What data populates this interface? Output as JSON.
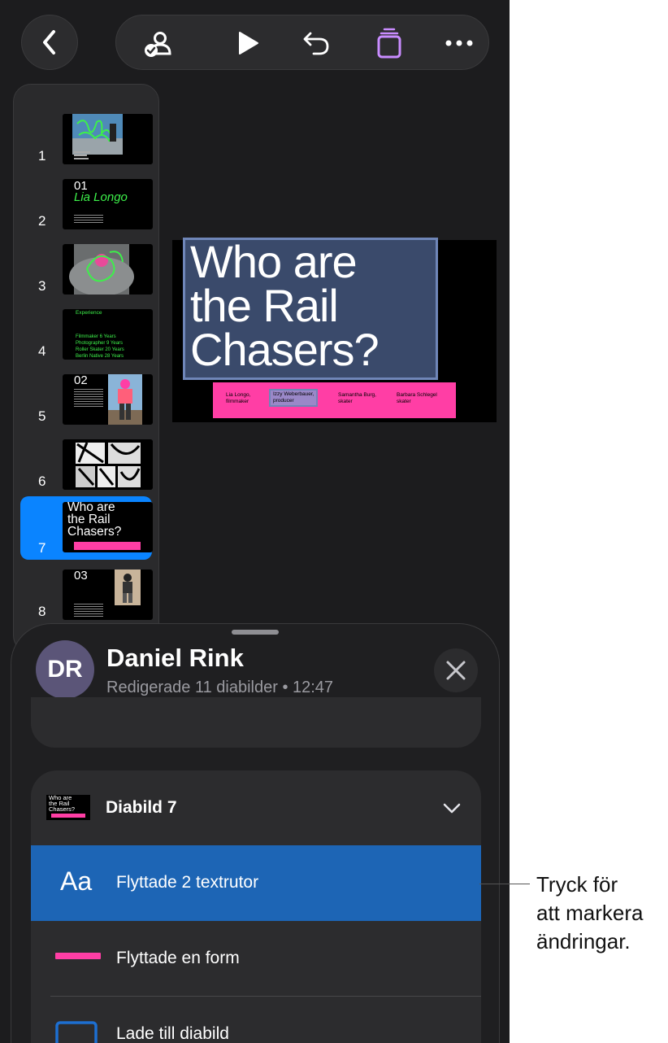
{
  "toolbar": {
    "back": "back",
    "icons": [
      "collaborate-icon",
      "play-icon",
      "undo-icon",
      "slides-stack-icon",
      "more-icon"
    ]
  },
  "navigator": {
    "slides": [
      {
        "number": "1",
        "text": "",
        "selected": false
      },
      {
        "number": "2",
        "heading": "01",
        "text": "Lia Longo",
        "selected": false
      },
      {
        "number": "3",
        "text": "",
        "selected": false
      },
      {
        "number": "4",
        "heading": "Experience",
        "rows": [
          "Filmmaker 6 Years",
          "Photographer 9 Years",
          "Roller Skater 20 Years",
          "Berlin Native 28 Years"
        ],
        "selected": false
      },
      {
        "number": "5",
        "heading": "02",
        "text": "",
        "selected": false
      },
      {
        "number": "6",
        "text": "",
        "selected": false
      },
      {
        "number": "7",
        "text": "Who are\nthe Rail\nChasers?",
        "selected": true
      },
      {
        "number": "8",
        "heading": "03",
        "text": "",
        "selected": false
      }
    ]
  },
  "slide": {
    "title": "Who are\nthe Rail\nChasers?",
    "credits": [
      {
        "name": "Lia Longo,",
        "role": "filmmaker"
      },
      {
        "name": "Izzy Weberbauer,",
        "role": "producer"
      },
      {
        "name": "Samantha Burg,",
        "role": "skater"
      },
      {
        "name": "Barbara Schlegel",
        "role": "skater"
      }
    ],
    "accent_color": "#ff3ea5"
  },
  "sheet": {
    "avatar_initials": "DR",
    "user_name": "Daniel Rink",
    "subtitle": "Redigerade 11 diabilder • 12:47",
    "group_title": "Diabild 7",
    "mini_thumb_text": "Who are\nthe Rail\nChasers?",
    "changes": [
      {
        "icon_text": "Aa",
        "label": "Flyttade 2 textrutor",
        "active": true
      },
      {
        "label": "Flyttade en form",
        "active": false
      },
      {
        "label": "Lade till diabild",
        "active": false
      }
    ],
    "active_color": "#1d65b5"
  },
  "callout": {
    "text": "Tryck för\natt markera\nändringar."
  }
}
